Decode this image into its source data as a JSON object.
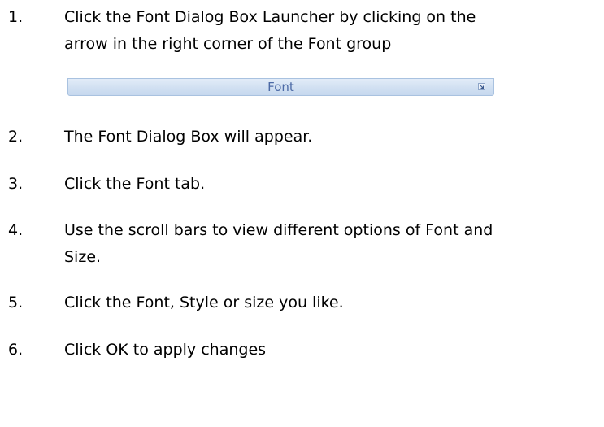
{
  "steps": [
    {
      "number": "1.",
      "line1": "Click the Font Dialog Box Launcher by clicking on the",
      "line2": "arrow in the right corner of the Font group"
    },
    {
      "number": "2.",
      "line1": "The Font Dialog Box will appear."
    },
    {
      "number": "3.",
      "line1": "Click the Font tab."
    },
    {
      "number": "4.",
      "line1": "Use the scroll bars to view different options of Font and",
      "line2": "Size."
    },
    {
      "number": "5.",
      "line1": "Click the Font, Style or size you like."
    },
    {
      "number": "6.",
      "line1": "Click OK to apply changes"
    }
  ],
  "font_group": {
    "label": "Font",
    "launcher_icon": "dialog-launcher-icon"
  },
  "colors": {
    "group_label": "#4c6aa6",
    "group_background": "#d1e0f2",
    "group_border": "#a9c2e0"
  }
}
